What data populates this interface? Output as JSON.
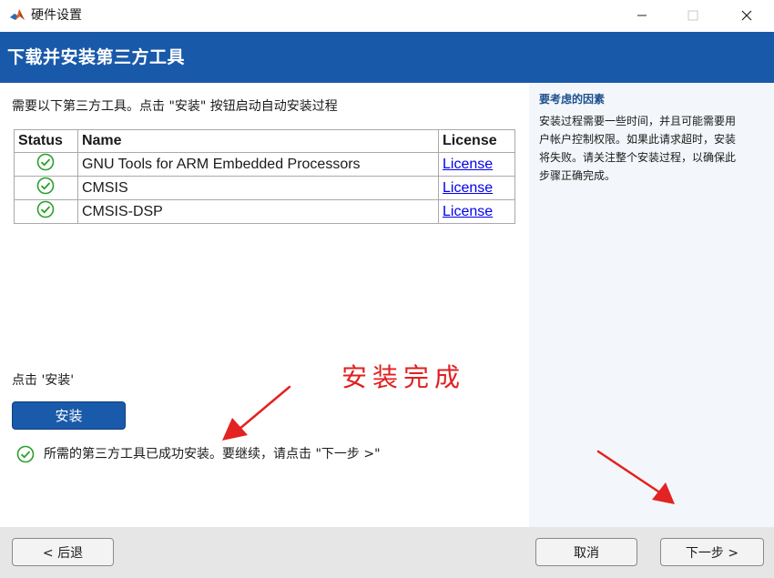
{
  "window": {
    "title": "硬件设置",
    "controls": {
      "minimize": "minimize-icon",
      "maximize": "maximize-icon",
      "close": "close-icon"
    }
  },
  "header": {
    "title": "下载并安装第三方工具"
  },
  "main": {
    "instruction": "需要以下第三方工具。点击 \"安装\" 按钮启动自动安装过程",
    "table": {
      "headers": [
        "Status",
        "Name",
        "License"
      ],
      "rows": [
        {
          "status": "check-circle-icon",
          "name": "GNU Tools for ARM Embedded Processors",
          "license": "License"
        },
        {
          "status": "check-circle-icon",
          "name": "CMSIS",
          "license": "License"
        },
        {
          "status": "check-circle-icon",
          "name": "CMSIS-DSP",
          "license": "License"
        }
      ]
    },
    "click_install": "点击 '安装'",
    "install_button": "安装",
    "success_message": "所需的第三方工具已成功安装。要继续，请点击 \"下一步 >\"",
    "annotation": "安装完成"
  },
  "side_panel": {
    "title": "要考虑的因素",
    "lines": [
      "安装过程需要一些时间，并且可能需要用",
      "户帐户控制权限。如果此请求超时，安装",
      "将失败。请关注整个安装过程，以确保此",
      "步骤正确完成。"
    ]
  },
  "footer": {
    "back": "< 后退",
    "cancel": "取消",
    "next": "下一步 >"
  },
  "colors": {
    "header_bg": "#1959a9",
    "install_button": "#1a5aaa",
    "side_panel_bg": "#f3f7fb",
    "footer_bg": "#e6e6e6",
    "success_green": "#2aa02a",
    "annotation_red": "#e02020",
    "link_blue": "#0000ee"
  }
}
